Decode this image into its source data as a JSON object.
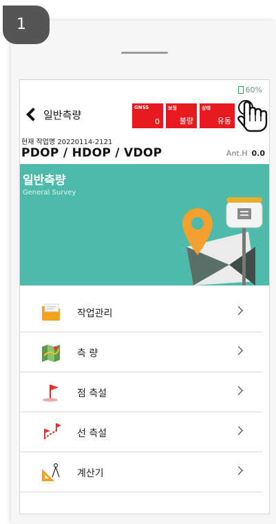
{
  "step": {
    "number": "1"
  },
  "status_bar": {
    "battery": "60%"
  },
  "header": {
    "title": "일반측량",
    "gnss": {
      "label": "GNSS",
      "value": "0"
    },
    "correction": {
      "label": "보정",
      "value": "불량"
    },
    "state": {
      "label": "상태",
      "value": "유동"
    }
  },
  "job": {
    "label": "현재 작업명 20220114-2121"
  },
  "dop": {
    "text": "PDOP  / HDOP  / VDOP",
    "ant_label": "Ant.H",
    "ant_value": "0.0"
  },
  "banner": {
    "title": "일반측량",
    "subtitle": "General Survey"
  },
  "menu": [
    {
      "label": "작업관리",
      "icon": "folder-icon"
    },
    {
      "label": "측 량",
      "icon": "map-icon"
    },
    {
      "label": "점 측설",
      "icon": "flag-icon"
    },
    {
      "label": "선 측설",
      "icon": "line-flags-icon"
    },
    {
      "label": "계산기",
      "icon": "calculator-icon"
    }
  ],
  "colors": {
    "accent": "#4dbaaa",
    "status_red": "#e8191f",
    "battery_green": "#2aa84a"
  }
}
